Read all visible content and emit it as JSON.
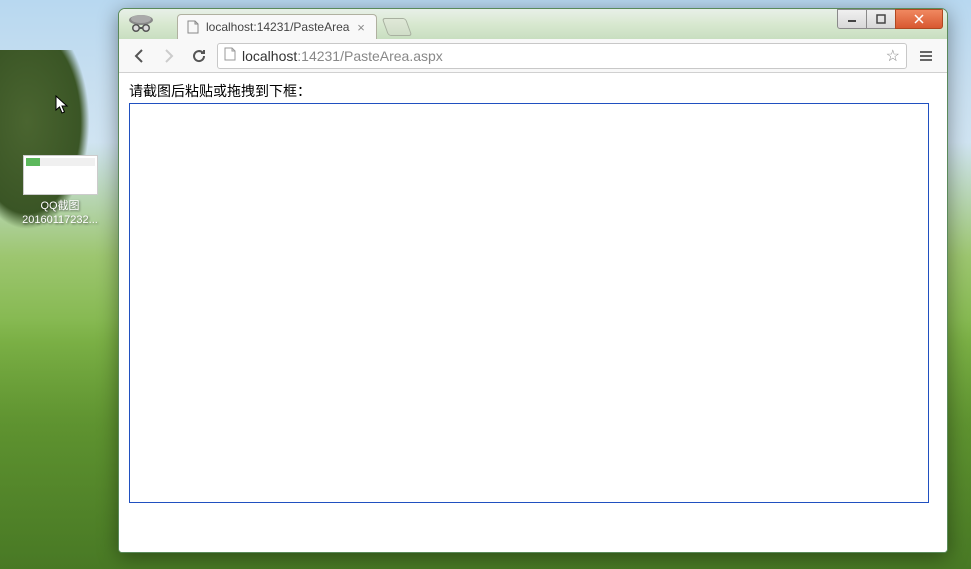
{
  "desktop": {
    "icon": {
      "label_line1": "QQ截图",
      "label_line2": "20160117232..."
    }
  },
  "browser": {
    "tab": {
      "title": "localhost:14231/PasteArea"
    },
    "url": {
      "host": "localhost",
      "rest": ":14231/PasteArea.aspx"
    },
    "window_controls": {
      "minimize": "—",
      "maximize": "▢",
      "close": "✕"
    }
  },
  "page": {
    "instruction": "请截图后粘贴或拖拽到下框："
  }
}
